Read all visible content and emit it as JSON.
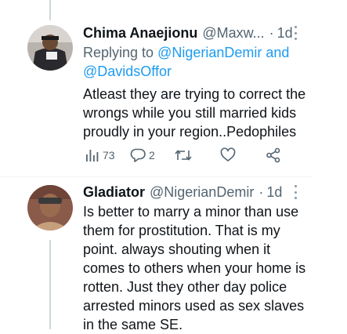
{
  "tweets": [
    {
      "name": "Chima Anaejionu",
      "handle": "@Maxw...",
      "dot": "·",
      "time": "1d",
      "reply_prefix": "Replying to",
      "reply_mention_1": "@NigerianDemir",
      "reply_and": "and",
      "reply_mention_2": "@DavidsOffor",
      "text": "Atleast they are trying to correct the wrongs while you still married kids proudly in your region..Pedophiles",
      "views": "73",
      "replies": "2",
      "retweets": "",
      "likes": ""
    },
    {
      "name": "Gladiator",
      "handle": "@NigerianDemir",
      "dot": "·",
      "time": "1d",
      "text": "Is better to marry a minor than use them for prostitution. That is my point. always shouting when it comes to others when your home is rotten. Just they other day police arrested minors used as sex slaves in the same SE."
    }
  ],
  "icons": {
    "views": "bar-chart-icon",
    "reply": "speech-bubble-icon",
    "retweet": "retweet-icon",
    "like": "heart-icon",
    "share": "share-icon",
    "more": "more-vertical-icon"
  },
  "colors": {
    "text": "#0f1419",
    "secondary": "#536471",
    "link": "#1d9bf0",
    "thread_line": "#cfd9de"
  }
}
